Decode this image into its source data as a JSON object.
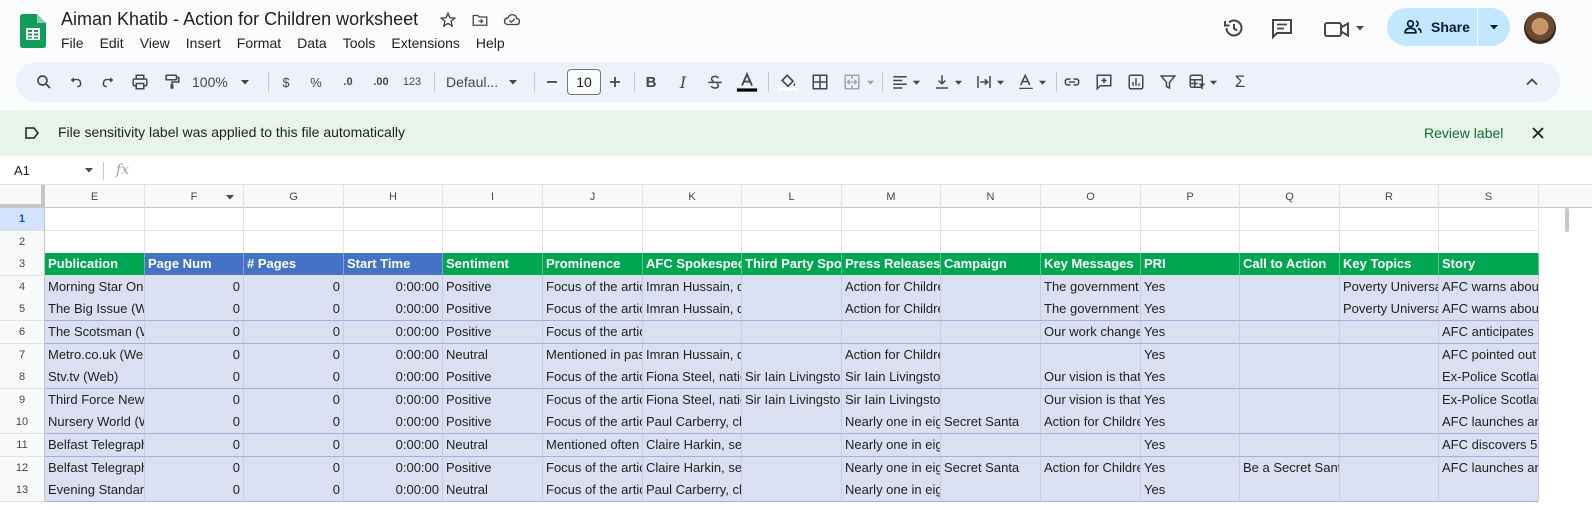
{
  "doc": {
    "title": "Aiman Khatib - Action for Children worksheet",
    "menus": [
      "File",
      "Edit",
      "View",
      "Insert",
      "Format",
      "Data",
      "Tools",
      "Extensions",
      "Help"
    ]
  },
  "header": {
    "share_label": "Share",
    "icons": [
      "history-icon",
      "comments-icon",
      "meet-icon",
      "share-caret-icon"
    ]
  },
  "toolbar": {
    "zoom": "100%",
    "currency": "$",
    "percent": "%",
    "dec_decrease": ".0",
    "dec_increase": ".00",
    "number_format": "123",
    "font": "Defaul...",
    "font_size": "10"
  },
  "banner": {
    "text": "File sensitivity label was applied to this file automatically",
    "link": "Review label"
  },
  "formula_bar": {
    "cell_ref": "A1",
    "fx": "fx"
  },
  "grid": {
    "columns": [
      "E",
      "F",
      "G",
      "H",
      "I",
      "J",
      "K",
      "L",
      "M",
      "N",
      "O",
      "P",
      "Q",
      "R",
      "S"
    ],
    "row_numbers": [
      "1",
      "2",
      "3",
      "4",
      "5",
      "6",
      "7",
      "8",
      "9",
      "10",
      "11",
      "12",
      "13"
    ],
    "header_cells": [
      "Publication",
      "Page Num",
      "# Pages",
      "Start Time",
      "Sentiment",
      "Prominence",
      "AFC Spokespeople",
      "Third Party Spokespeople",
      "Press Releases",
      "Campaign",
      "Key Messages",
      "PRI",
      "Call to Action",
      "Key Topics",
      "Story"
    ],
    "header_colors": [
      "#00a650",
      "#4472c4",
      "#4472c4",
      "#4472c4",
      "#00a650",
      "#00a650",
      "#00a650",
      "#00a650",
      "#00a650",
      "#00a650",
      "#00a650",
      "#00a650",
      "#00a650",
      "#00a650",
      "#00a650"
    ],
    "rows": [
      [
        "Morning Star Online",
        "0",
        "0",
        "0:00:00",
        "Positive",
        "Focus of the article",
        "Imran Hussain, d",
        "",
        "Action for Children",
        "",
        "The government",
        "Yes",
        "",
        "Poverty Universal",
        "AFC warns about"
      ],
      [
        "The Big Issue (Web)",
        "0",
        "0",
        "0:00:00",
        "Positive",
        "Focus of the article",
        "Imran Hussain, d",
        "",
        "Action for Children",
        "",
        "The government",
        "Yes",
        "",
        "Poverty Universal",
        "AFC warns about"
      ],
      [
        "The Scotsman (Web)",
        "0",
        "0",
        "0:00:00",
        "Positive",
        "Focus of the article",
        "",
        "",
        "",
        "",
        "Our work changes",
        "Yes",
        "",
        "",
        "AFC anticipates c"
      ],
      [
        "Metro.co.uk (Web)",
        "0",
        "0",
        "0:00:00",
        "Neutral",
        "Mentioned in passing",
        "Imran Hussain, d",
        "",
        "Action for Children",
        "",
        "",
        "Yes",
        "",
        "",
        "AFC pointed out"
      ],
      [
        "Stv.tv (Web)",
        "0",
        "0",
        "0:00:00",
        "Positive",
        "Focus of the article",
        "Fiona Steel, natio",
        "Sir Iain Livingston",
        "Sir Iain Livingston",
        "",
        "Our vision is that",
        "Yes",
        "",
        "",
        "Ex-Police Scotlan"
      ],
      [
        "Third Force News",
        "0",
        "0",
        "0:00:00",
        "Positive",
        "Focus of the article",
        "Fiona Steel, natio",
        "Sir Iain Livingston",
        "Sir Iain Livingston",
        "",
        "Our vision is that",
        "Yes",
        "",
        "",
        "Ex-Police Scotlan"
      ],
      [
        "Nursery World (Web)",
        "0",
        "0",
        "0:00:00",
        "Positive",
        "Focus of the article",
        "Paul Carberry, ch",
        "",
        "Nearly one in eight",
        "Secret Santa",
        "Action for Childre",
        "Yes",
        "",
        "",
        "AFC launches an"
      ],
      [
        "Belfast Telegraph",
        "0",
        "0",
        "0:00:00",
        "Neutral",
        "Mentioned often",
        "Claire Harkin, se",
        "",
        "Nearly one in eight",
        "",
        "",
        "Yes",
        "",
        "",
        "AFC discovers 50"
      ],
      [
        "Belfast Telegraph",
        "0",
        "0",
        "0:00:00",
        "Positive",
        "Focus of the article",
        "Claire Harkin, se",
        "",
        "Nearly one in eight",
        "Secret Santa",
        "Action for Childre",
        "Yes",
        "Be a Secret Santa",
        "",
        "AFC launches an"
      ],
      [
        "Evening Standard",
        "0",
        "0",
        "0:00:00",
        "Neutral",
        "Focus of the article",
        "Paul Carberry, ch",
        "",
        "Nearly one in eight",
        "",
        "",
        "Yes",
        "",
        "",
        ""
      ]
    ]
  }
}
